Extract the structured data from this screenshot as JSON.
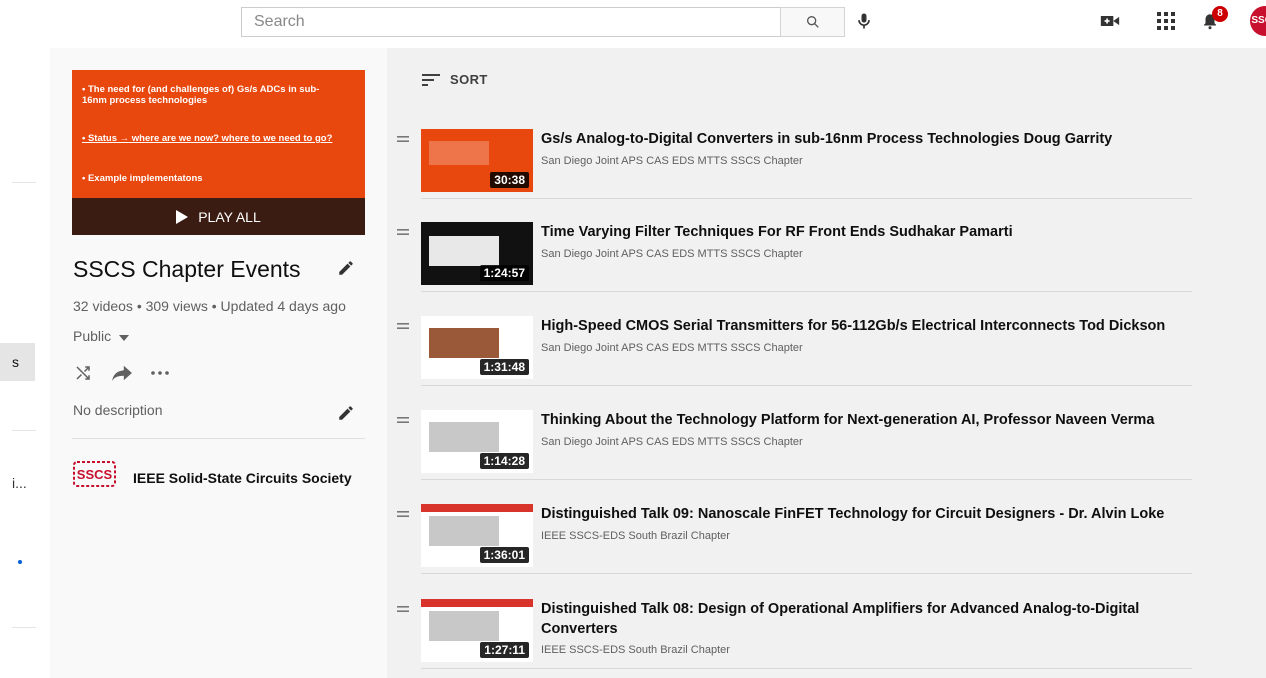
{
  "header": {
    "search_placeholder": "Search",
    "notification_count": "8",
    "avatar_text": "SSCS"
  },
  "leftnav": {
    "selected_label": "s",
    "truncated_label": "i..."
  },
  "playlist": {
    "thumb_lines": [
      "• The need for (and challenges of) Gs/s ADCs in sub-",
      "  16nm process technologies",
      "• Status → where are we now? where to we need to go?",
      "• Example implementatons"
    ],
    "play_all_label": "PLAY ALL",
    "title": "SSCS Chapter Events",
    "meta": "32 videos • 309 views • Updated 4 days ago",
    "privacy": "Public",
    "description": "No description",
    "owner": "IEEE Solid-State Circuits Society",
    "owner_logo_text": "SSCS"
  },
  "sort_label": "SORT",
  "videos": [
    {
      "title": "Gs/s Analog-to-Digital Converters in sub-16nm Process Technologies Doug Garrity",
      "channel": "San Diego Joint APS CAS EDS MTTS SSCS Chapter",
      "duration": "30:38"
    },
    {
      "title": "Time Varying Filter Techniques For RF Front Ends Sudhakar Pamarti",
      "channel": "San Diego Joint APS CAS EDS MTTS SSCS Chapter",
      "duration": "1:24:57"
    },
    {
      "title": "High-Speed CMOS Serial Transmitters for 56-112Gb/s Electrical Interconnects Tod Dickson",
      "channel": "San Diego Joint APS CAS EDS MTTS SSCS Chapter",
      "duration": "1:31:48"
    },
    {
      "title": "Thinking About the Technology Platform for Next-generation AI, Professor Naveen Verma",
      "channel": "San Diego Joint APS CAS EDS MTTS SSCS Chapter",
      "duration": "1:14:28"
    },
    {
      "title": "Distinguished Talk 09: Nanoscale FinFET Technology for Circuit Designers - Dr. Alvin Loke",
      "channel": "IEEE SSCS-EDS South Brazil Chapter",
      "duration": "1:36:01"
    },
    {
      "title": "Distinguished Talk 08: Design of Operational Amplifiers for Advanced Analog-to-Digital Converters",
      "channel": "IEEE SSCS-EDS South Brazil Chapter",
      "duration": "1:27:11"
    }
  ],
  "colors": {
    "accent": "#e8470d",
    "notification": "#cc0000",
    "brand": "#c8102e"
  }
}
